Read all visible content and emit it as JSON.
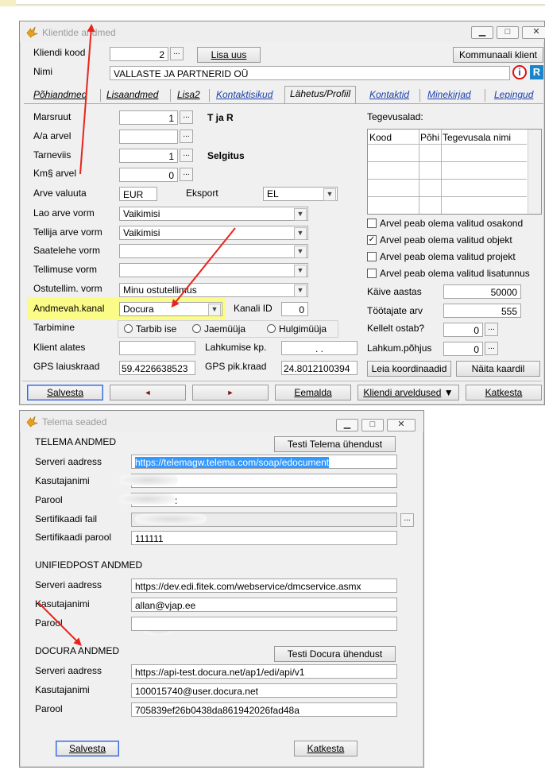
{
  "client_window": {
    "title": "Klientide andmed",
    "client_code_label": "Kliendi kood",
    "client_code_value": "2",
    "add_new_label": "Lisa uus",
    "utility_client_label": "Kommunaali klient",
    "name_label": "Nimi",
    "name_value": "VALLASTE JA PARTNERID OÜ",
    "tabs": [
      "Põhiandmed",
      "Lisaandmed",
      "Lisa2",
      "Kontaktisikud",
      "Lähetus/Profiil",
      "Kontaktid",
      "Minekirjad",
      "Lepingud"
    ],
    "route_label": "Marsruut",
    "route_value": "1",
    "route_desc": "T ja R",
    "aa_invoice_label": "A/a arvel",
    "delivery_label": "Tarneviis",
    "delivery_value": "1",
    "delivery_desc": "Selgitus",
    "vat_invoice_label": "Km§ arvel",
    "vat_invoice_value": "0",
    "currency_label": "Arve valuuta",
    "currency_value": "EUR",
    "export_label": "Eksport",
    "export_value": "EL",
    "warehouse_form_label": "Lao arve vorm",
    "warehouse_form_value": "Vaikimisi",
    "orderer_form_label": "Tellija arve vorm",
    "orderer_form_value": "Vaikimisi",
    "waybill_form_label": "Saatelehe vorm",
    "order_form_label": "Tellimuse vorm",
    "purchase_form_label": "Ostutellim. vorm",
    "purchase_form_value": "Minu ostutellimus",
    "data_channel_label": "Andmevah.kanal",
    "data_channel_value": "Docura",
    "channel_id_label": "Kanali ID",
    "channel_id_value": "0",
    "consumption_label": "Tarbimine",
    "radio_options": [
      "Tarbib ise",
      "Jaemüüja",
      "Hulgimüüja"
    ],
    "client_since_label": "Klient alates",
    "departure_label": "Lahkumise kp.",
    "departure_value": ". .",
    "gps_lat_label": "GPS laiuskraad",
    "gps_lat_value": "59.4226638523",
    "gps_lon_label": "GPS pik.kraad",
    "gps_lon_value": "24.8012100394",
    "activities_label": "Tegevusalad:",
    "grid_headers": [
      "Kood",
      "Põhi",
      "Tegevusala nimi"
    ],
    "checkboxes": [
      {
        "label": "Arvel peab olema valitud osakond",
        "checked": false
      },
      {
        "label": "Arvel peab olema valitud objekt",
        "checked": true
      },
      {
        "label": "Arvel peab olema valitud projekt",
        "checked": false
      },
      {
        "label": "Arvel peab olema valitud lisatunnus",
        "checked": false
      }
    ],
    "turnover_year_label": "Käive aastas",
    "turnover_year_value": "50000",
    "employees_label": "Töötajate arv",
    "employees_value": "555",
    "buys_from_label": "Kellelt ostab?",
    "buys_from_value": "0",
    "leave_reason_label": "Lahkum.põhjus",
    "leave_reason_value": "0",
    "find_coords_label": "Leia koordinaadid",
    "show_map_label": "Näita kaardil",
    "save_label": "Salvesta",
    "prev_glyph": "◄",
    "next_glyph": "►",
    "remove_label": "Eemalda",
    "client_invoices_label": "Kliendi arveldused",
    "client_invoices_glyph": "▼",
    "cancel_label": "Katkesta"
  },
  "telema_window": {
    "title": "Telema seaded",
    "telema_header": "TELEMA ANDMED",
    "test_telema_label": "Testi Telema ühendust",
    "server_label": "Serveri aadress",
    "telema_server_value": "https://telemagw.telema.com/soap/edocument",
    "username_label": "Kasutajanimi",
    "password_label": "Parool",
    "password_dot": ":",
    "cert_file_label": "Sertifikaadi fail",
    "cert_pass_label": "Sertifikaadi parool",
    "cert_pass_value": "111111",
    "unified_header": "UNIFIEDPOST ANDMED",
    "unified_server_value": "https://dev.edi.fitek.com/webservice/dmcservice.asmx",
    "unified_user_value": "allan@vjap.ee",
    "docura_header": "DOCURA ANDMED",
    "test_docura_label": "Testi Docura ühendust",
    "docura_server_value": "https://api-test.docura.net/ap1/edi/api/v1",
    "docura_user_value": "100015740@user.docura.net",
    "docura_pass_value": "705839ef26b0438da861942026fad48a",
    "save_label": "Salvesta",
    "cancel_label": "Katkesta",
    "dots": "..."
  },
  "colors": {
    "annotation_arrow": "#e8241c",
    "highlight": "#ffff66",
    "tab_link": "#1b3fa8",
    "selection": "#3399ff"
  }
}
